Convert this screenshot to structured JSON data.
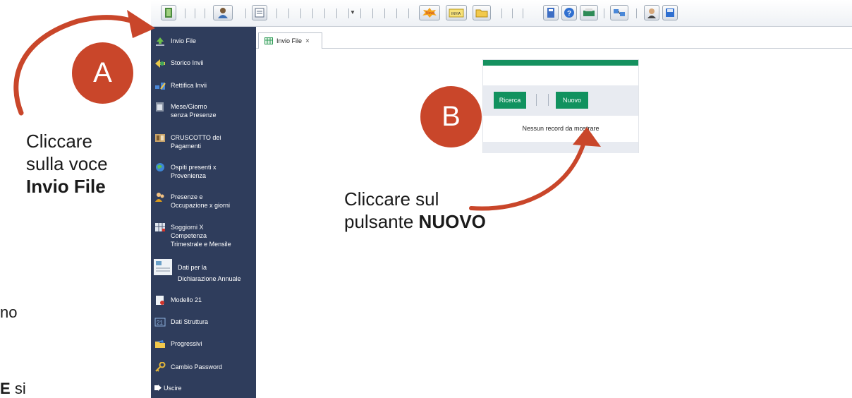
{
  "toolbar": {
    "buttons": [
      "exit-door-icon",
      "user-menu-icon",
      "form-icon",
      "news-icon",
      "invia-icon",
      "folder-icon",
      "book-icon",
      "help-icon",
      "print-icon",
      "network-icon",
      "operator-icon",
      "save-icon"
    ]
  },
  "sidebar": {
    "items": [
      {
        "label": "Invio File",
        "icon": "upload-icon"
      },
      {
        "label": "Storico Invii",
        "icon": "history-icon"
      },
      {
        "label": "Rettifica Invii",
        "icon": "edit-icon"
      },
      {
        "label": "Mese/Giorno\nsenza Presenze",
        "icon": "calendar-icon"
      },
      {
        "label": "CRUSCOTTO dei\nPagamenti",
        "icon": "dashboard-icon"
      },
      {
        "label": "Ospiti presenti x\nProvenienza",
        "icon": "globe-icon"
      },
      {
        "label": "Presenze e\nOccupazione x giorni",
        "icon": "people-icon"
      },
      {
        "label": "Soggiorni X\nCompetenza\nTrimestrale e Mensile",
        "icon": "grid-icon"
      },
      {
        "label": "Dati per la\nDichiarazione Annuale",
        "icon": "document-icon"
      },
      {
        "label": "Modello 21",
        "icon": "model-icon"
      },
      {
        "label": "Dati Struttura",
        "icon": "building-icon"
      },
      {
        "label": "Progressivi",
        "icon": "folder-icon"
      },
      {
        "label": "Cambio Password",
        "icon": "key-icon"
      },
      {
        "label": "Uscire",
        "icon": "logout-icon"
      }
    ]
  },
  "tabs": [
    {
      "label": "Invio File",
      "close": "×"
    }
  ],
  "panel": {
    "search_label": "Ricerca",
    "new_label": "Nuovo",
    "empty_message": "Nessun record da mostrare"
  },
  "annotations": {
    "badge_a": "A",
    "badge_b": "B",
    "note_a_line1": "Cliccare",
    "note_a_line2": "sulla voce",
    "note_a_bold": "Invio File",
    "note_b_line1": "Cliccare sul",
    "note_b_line2": "pulsante",
    "note_b_bold": "NUOVO",
    "fragment_1": "no",
    "fragment_2_bold": "E",
    "fragment_2": "si"
  },
  "colors": {
    "sidebar": "#2f3d5c",
    "accent_green": "#11925f",
    "annotation_red": "#c9462a"
  }
}
